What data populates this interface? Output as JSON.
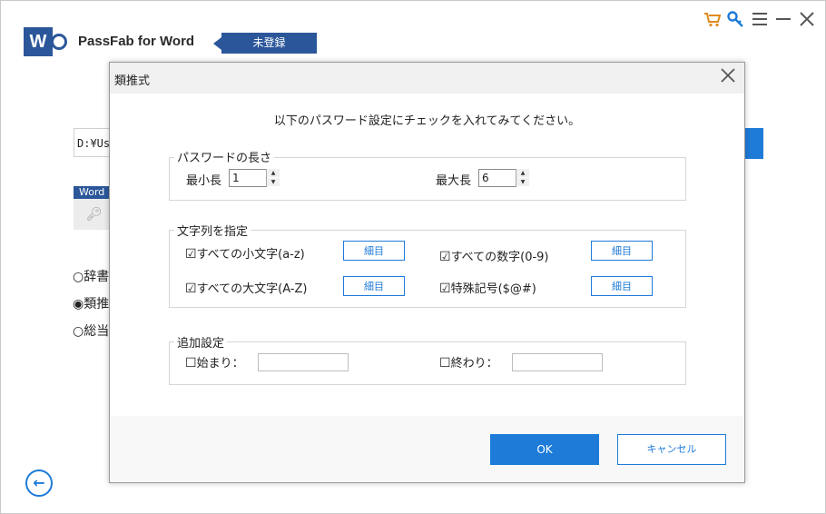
{
  "app": {
    "logo_letter": "W",
    "title": "PassFab for Word",
    "badge": "未登録"
  },
  "topbar_icons": [
    "cart-icon",
    "key-icon",
    "menu-icon",
    "minimize-icon",
    "close-icon"
  ],
  "background": {
    "path_value": "D:¥Us",
    "word_label": "Word",
    "modes": [
      {
        "label": "辞書",
        "selected": false
      },
      {
        "label": "類推",
        "selected": true
      },
      {
        "label": "総当",
        "selected": false
      }
    ]
  },
  "dialog": {
    "title": "類推式",
    "instruction": "以下のパスワード設定にチェックを入れてみてください。",
    "length_group": {
      "legend": "パスワードの長さ",
      "min_label": "最小長",
      "min_value": "1",
      "max_label": "最大長",
      "max_value": "6"
    },
    "charset_group": {
      "legend": "文字列を指定",
      "options": [
        {
          "label": "すべての小文字(a-z)",
          "checked": true,
          "detail": "細目"
        },
        {
          "label": "すべての数字(0-9)",
          "checked": true,
          "detail": "細目"
        },
        {
          "label": "すべての大文字(A-Z)",
          "checked": true,
          "detail": "細目"
        },
        {
          "label": "特殊記号($@#)",
          "checked": true,
          "detail": "細目"
        }
      ]
    },
    "extra_group": {
      "legend": "追加設定",
      "start_label": "始まり：",
      "start_value": "",
      "end_label": "終わり：",
      "end_value": ""
    },
    "ok_label": "OK",
    "cancel_label": "キャンセル"
  },
  "colors": {
    "brand_blue": "#2b579a",
    "accent_blue": "#1e7bd8"
  }
}
